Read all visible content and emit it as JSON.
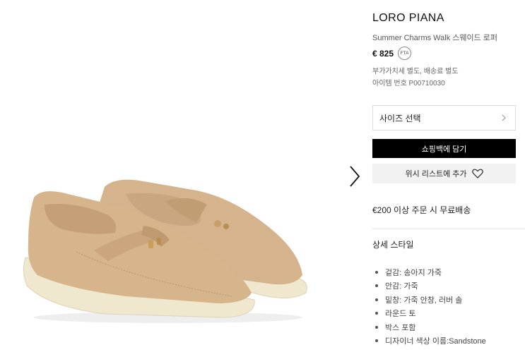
{
  "product": {
    "brand": "LORO PIANA",
    "name": "Summer Charms Walk 스웨이드 로퍼",
    "price": "€ 825",
    "fta_badge": "FTA",
    "tax_note": "부가가치세 별도, 배송료 별도",
    "item_number": "아이템 번호 P00710030"
  },
  "actions": {
    "size_select": "사이즈 선택",
    "add_to_bag": "쇼핑백에 담기",
    "wishlist": "위시 리스트에 추가"
  },
  "shipping": {
    "text": "€200 이상 주문 시 무료배송"
  },
  "details": {
    "title": "상세 스타일",
    "items": [
      "겉감: 송아지 가죽",
      "안감: 가죽",
      "밑창: 가죽 안창, 러버 솔",
      "라운드 토",
      "박스 포함",
      "디자이너 색상 이름:Sandstone"
    ]
  },
  "colors": {
    "suede": "#d2b08a",
    "sole": "#efe8cf",
    "button_primary": "#000000",
    "button_secondary": "#f2f2f2"
  },
  "icons": {
    "next": "chevron-right-icon",
    "size_chevron": "chevron-right-icon",
    "wishlist": "heart-icon"
  }
}
